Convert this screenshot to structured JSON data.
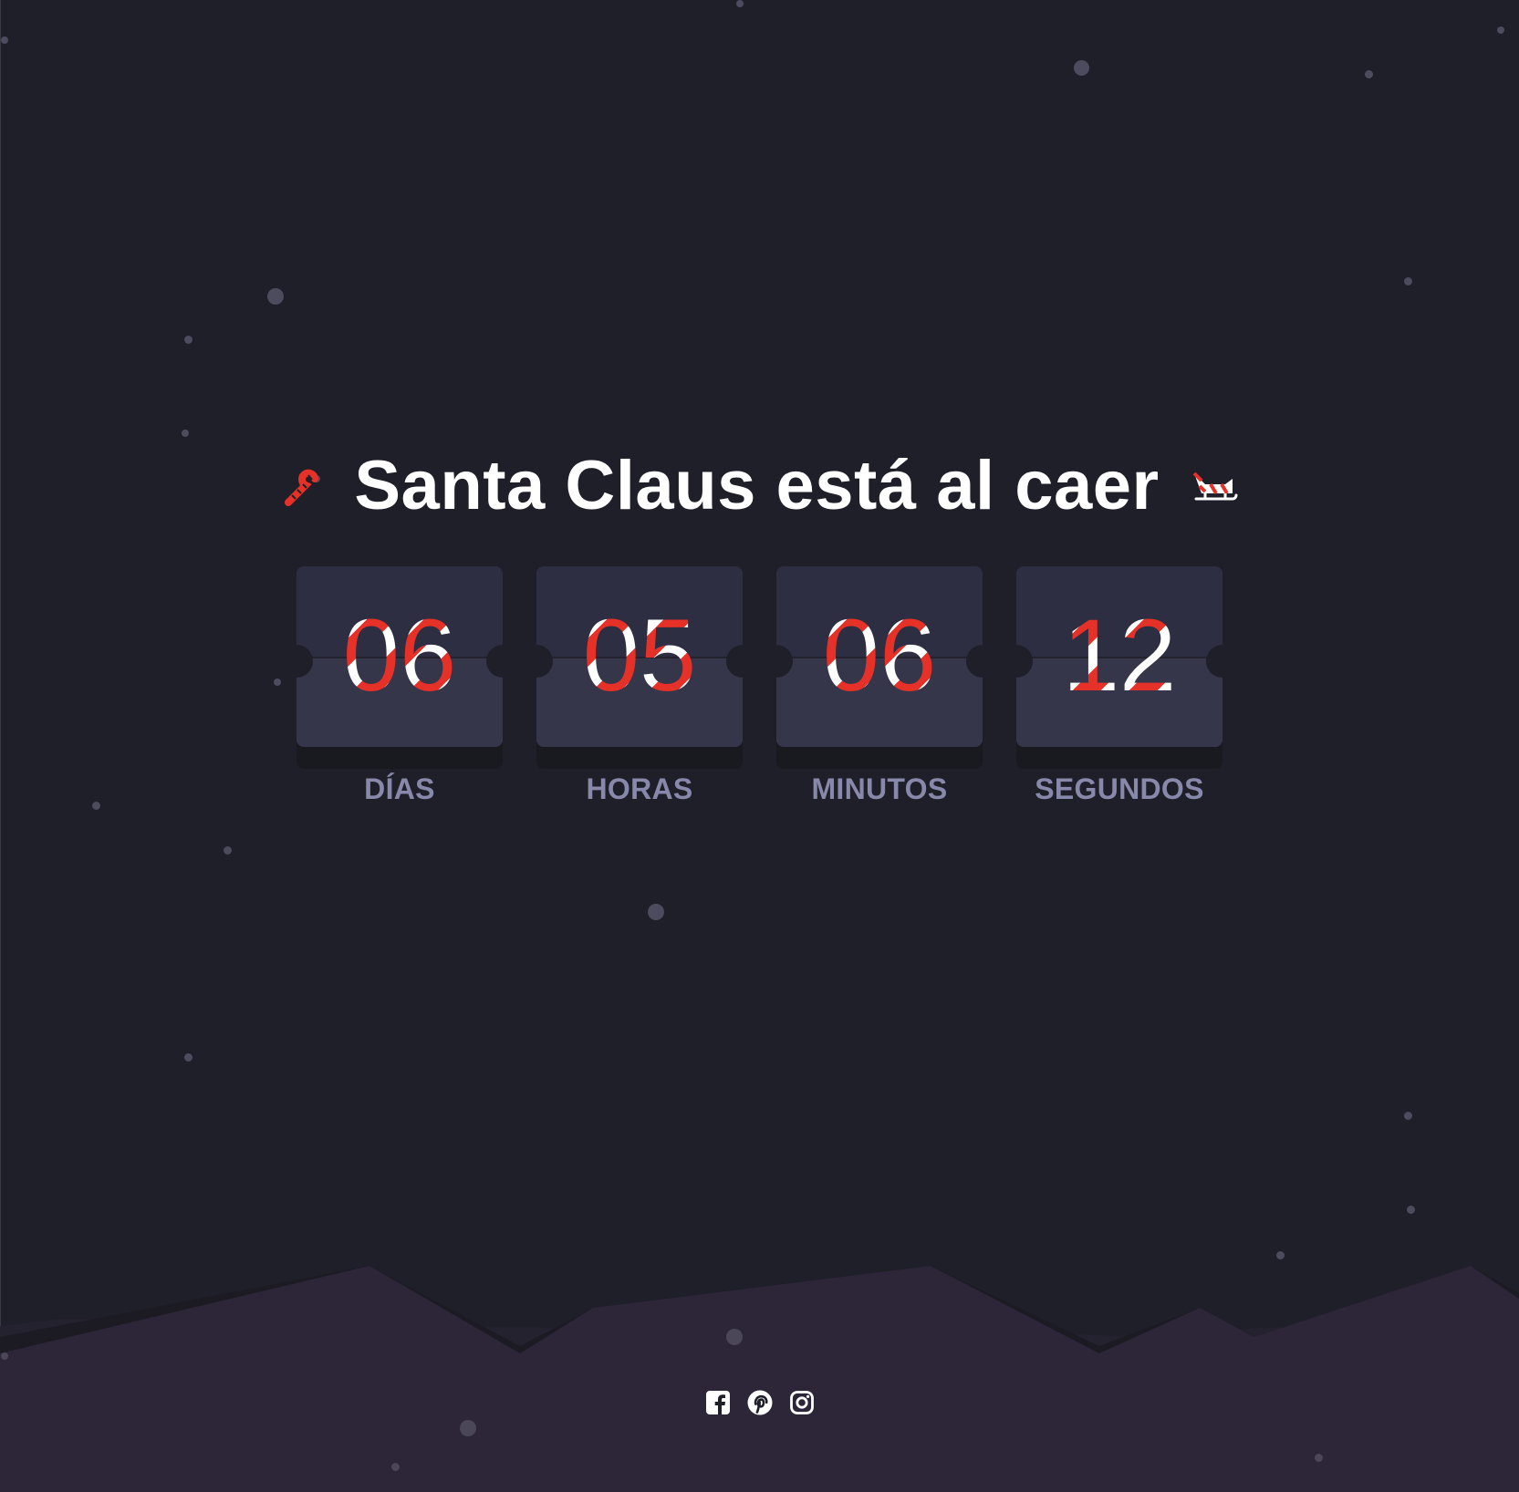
{
  "header": {
    "title": "Santa Claus está al caer",
    "left_icon": "candy-cane-icon",
    "right_icon": "sleigh-icon"
  },
  "countdown": [
    {
      "value": "06",
      "label": "DÍAS"
    },
    {
      "value": "05",
      "label": "HORAS"
    },
    {
      "value": "06",
      "label": "MINUTOS"
    },
    {
      "value": "12",
      "label": "SEGUNDOS"
    }
  ],
  "social": [
    {
      "icon": "facebook-icon"
    },
    {
      "icon": "pinterest-icon"
    },
    {
      "icon": "instagram-icon"
    }
  ],
  "colors": {
    "background": "#1f1f29",
    "card_top": "#2d2e42",
    "card_bottom": "#353649",
    "accent_red": "#e53127",
    "label": "#8788aa",
    "mountain_front": "#2d2538",
    "mountain_back": "#25222f"
  }
}
